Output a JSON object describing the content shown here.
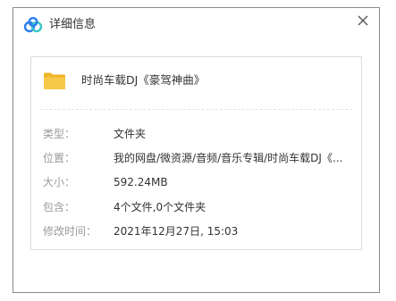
{
  "window": {
    "title": "详细信息"
  },
  "file": {
    "name": "时尚车载DJ《豪驾神曲》"
  },
  "details": [
    {
      "label": "类型：",
      "value": "文件夹"
    },
    {
      "label": "位置：",
      "value": "我的网盘/微资源/音频/音乐专辑/时尚车载DJ《..."
    },
    {
      "label": "大小：",
      "value": "592.24MB"
    },
    {
      "label": "包含：",
      "value": "4个文件,0个文件夹"
    },
    {
      "label": "修改时间：",
      "value": "2021年12月27日, 15:03"
    }
  ],
  "colors": {
    "folder": "#f5c33b",
    "logo_blue": "#2a7ef0",
    "logo_teal": "#3cc6c6"
  },
  "icons": {
    "logo": "baidu-netdisk-logo-icon",
    "close": "close-icon",
    "folder": "folder-icon"
  }
}
